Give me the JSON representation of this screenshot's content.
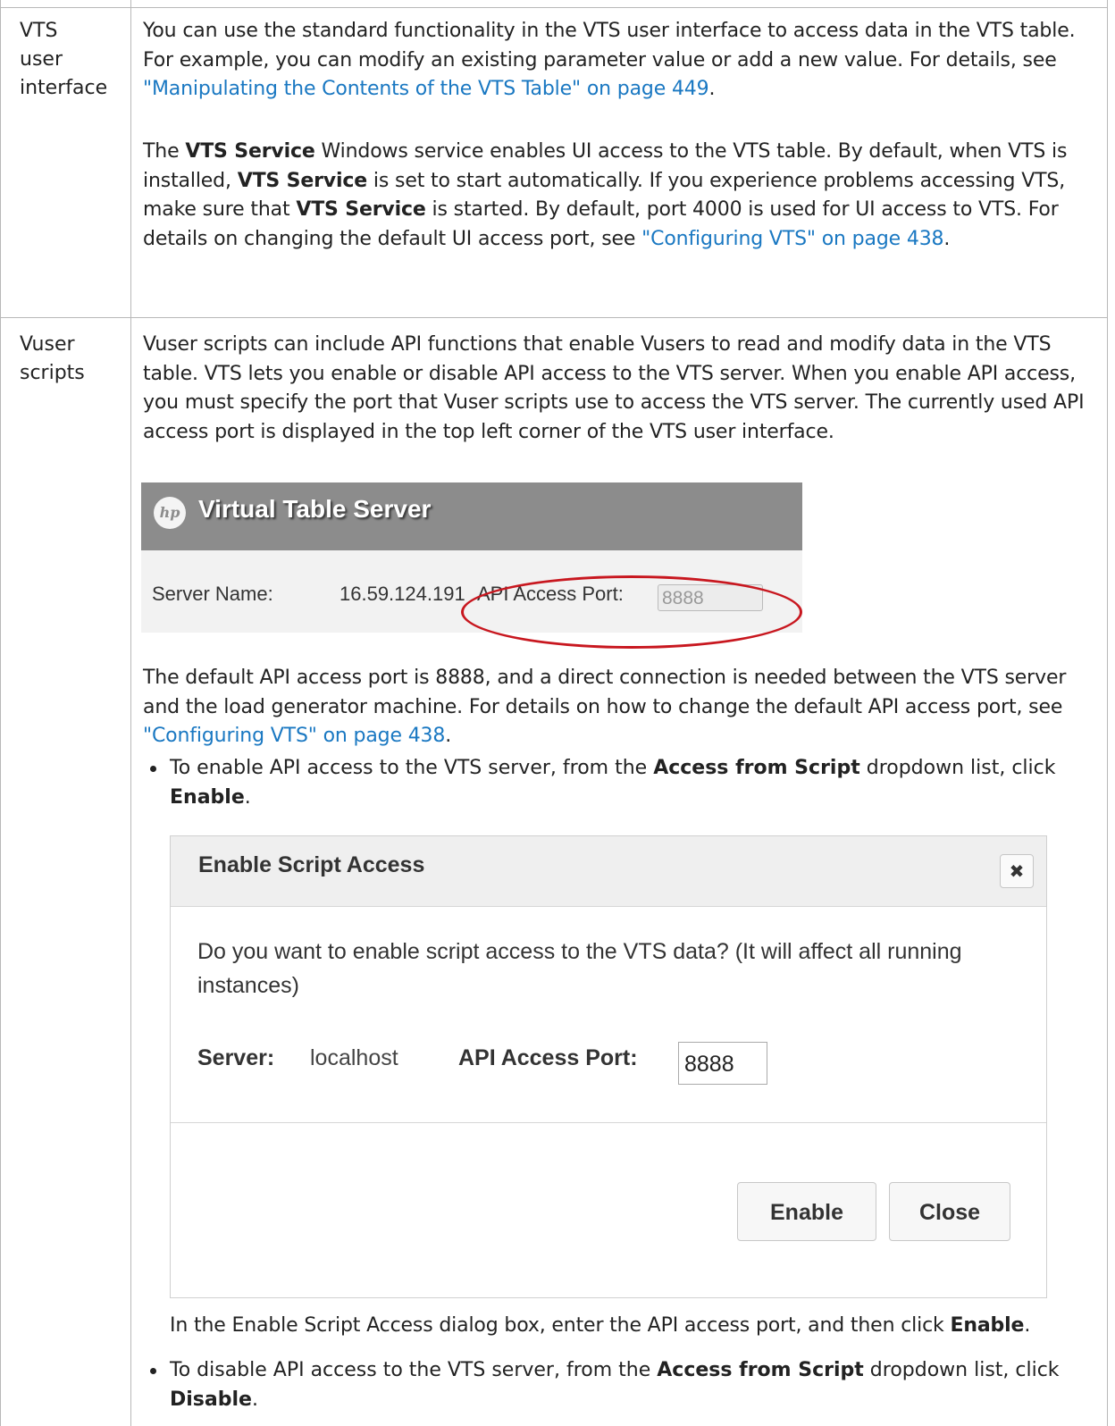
{
  "rows": [
    {
      "label": "VTS user interface",
      "label_lines": [
        "VTS",
        "user",
        "interface"
      ],
      "para1_a": "You can use the standard functionality in the VTS user interface to access data in the VTS table. For example, you can modify an existing parameter value or add a new value. For details, see ",
      "para1_link": "\"Manipulating the Contents of the VTS Table\" on page 449",
      "para1_b": ".",
      "para2_a": "The ",
      "para2_bold1": "VTS Service",
      "para2_b": " Windows service enables UI access to the VTS table. By default, when VTS is installed, ",
      "para2_bold2": "VTS Service",
      "para2_c": " is set to start automatically. If you experience problems accessing VTS, make sure that ",
      "para2_bold3": "VTS Service",
      "para2_d": " is started. By default, port 4000 is used for UI access to VTS. For details on changing the default UI access port, see ",
      "para2_link": "\"Configuring VTS\" on page 438",
      "para2_e": "."
    },
    {
      "label_lines": [
        "Vuser",
        "scripts"
      ],
      "para1": "Vuser scripts can include API functions that enable Vusers to read and modify data in the VTS table. VTS lets you enable or disable API access to the VTS server. When you enable API access, you must specify the port that Vuser scripts use to access the VTS server. The currently used API access port is displayed in the top left corner of the VTS user interface.",
      "para2_a": "The default API access port is 8888, and a direct connection is needed between the VTS server and the load generator machine. For details on how to change the default API access port, see ",
      "para2_link": "\"Configuring VTS\" on page 438",
      "para2_b": ".",
      "bullet1_a": "To enable API access to the VTS server, from the ",
      "bullet1_bold1": "Access from Script",
      "bullet1_b": " dropdown list, click ",
      "bullet1_bold2": "Enable",
      "bullet1_c": ".",
      "after_dialog_a": "In the Enable Script Access dialog box, enter the API access port, and then click ",
      "after_dialog_bold": "Enable",
      "after_dialog_b": ".",
      "bullet2_a": "To disable API access to the VTS server, from the ",
      "bullet2_bold1": "Access from Script",
      "bullet2_b": " dropdown list, click ",
      "bullet2_bold2": "Disable",
      "bullet2_c": "."
    }
  ],
  "vts_screenshot": {
    "logo_text": "hp",
    "title": "Virtual Table Server",
    "server_name_label": "Server Name:",
    "server_name_value": "16.59.124.191",
    "api_port_label": "API Access Port:",
    "api_port_value": "8888",
    "highlight_color": "#c8171f"
  },
  "dialog": {
    "title": "Enable Script Access",
    "close_icon": "close-icon",
    "message": "Do you want to enable script access to the VTS data? (It will affect all running instances)",
    "server_label": "Server:",
    "server_value": "localhost",
    "port_label": "API Access Port:",
    "port_value": "8888",
    "enable_label": "Enable",
    "close_label": "Close"
  },
  "colors": {
    "link": "#1a78c2",
    "border": "#b8b8b8"
  }
}
